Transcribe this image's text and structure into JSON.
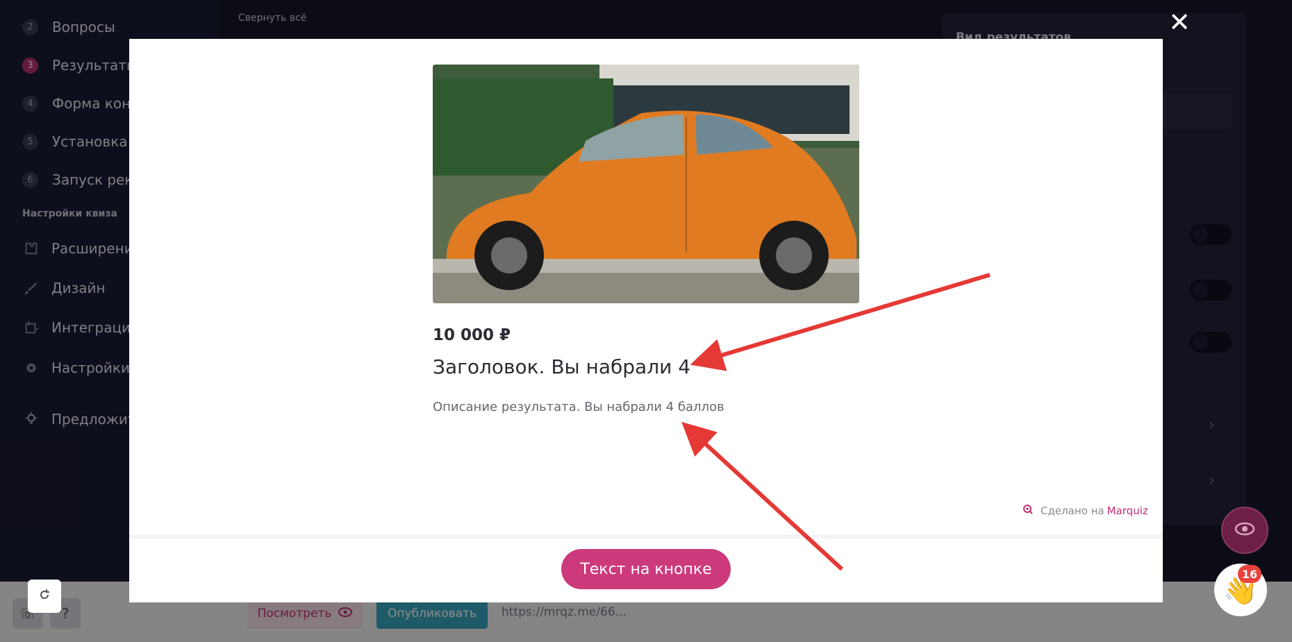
{
  "sidebar": {
    "items": [
      {
        "num": "2",
        "label": "Вопросы"
      },
      {
        "num": "3",
        "label": "Результаты"
      },
      {
        "num": "4",
        "label": "Форма конт"
      },
      {
        "num": "5",
        "label": "Установка к"
      },
      {
        "num": "6",
        "label": "Запуск рекл"
      }
    ],
    "section_title": "Настройки квиза",
    "settings": [
      {
        "icon": "puzzle-icon",
        "label": "Расширения"
      },
      {
        "icon": "brush-icon",
        "label": "Дизайн"
      },
      {
        "icon": "integration-icon",
        "label": "Интеграции"
      },
      {
        "icon": "gear-icon",
        "label": "Настройки"
      }
    ],
    "suggest_label": "Предложит"
  },
  "main": {
    "collapse_all": "Свернуть всё",
    "right_panel_title": "Вид результатов"
  },
  "bottom": {
    "preview_label": "Посмотреть",
    "publish_label": "Опубликовать",
    "link": "https://mrqz.me/66...",
    "help_label": "?"
  },
  "modal": {
    "close_label": "✕",
    "price": "10 000 ₽",
    "title": "Заголовок. Вы набрали 4",
    "description": "Описание результата. Вы набрали 4 баллов",
    "made_on_prefix": "Сделано на",
    "made_on_brand": "Marquiz",
    "button_label": "Текст на кнопке"
  },
  "floating": {
    "notification_count": "16"
  },
  "colors": {
    "accent": "#cc3a7c",
    "sidebar_bg": "#1b1c33",
    "arrow": "#e53935"
  }
}
